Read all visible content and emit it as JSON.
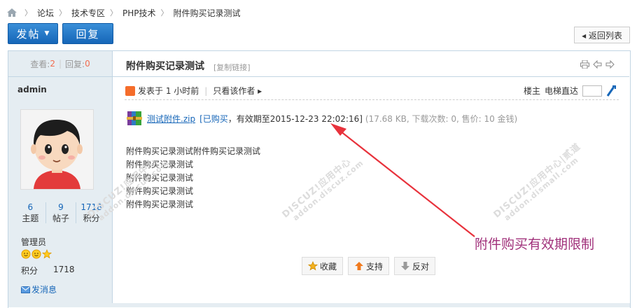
{
  "breadcrumb": [
    "论坛",
    "技术专区",
    "PHP技术",
    "附件购买记录测试"
  ],
  "toolbar": {
    "post_label": "发帖",
    "reply_label": "回复",
    "back_label": "◂ 返回列表"
  },
  "sidebar": {
    "views_label": "查看:",
    "views": "2",
    "replies_label": "回复:",
    "replies": "0",
    "username": "admin",
    "stats": [
      {
        "value": "6",
        "label": "主题"
      },
      {
        "value": "9",
        "label": "帖子"
      },
      {
        "value": "1718",
        "label": "积分"
      }
    ],
    "group": "管理员",
    "credit_label": "积分",
    "credit_value": "1718",
    "message_label": "发消息"
  },
  "thread": {
    "title": "附件购买记录测试",
    "copy_link": "[复制链接]"
  },
  "post": {
    "meta_posted": "发表于 1 小时前",
    "author_only": "只看该作者 ▸",
    "floor_label": "楼主",
    "elevator_label": "电梯直达"
  },
  "attachment": {
    "name": "测试附件.zip",
    "paid": "[已购买",
    "expiry": "，有效期至2015-12-23 22:02:16]",
    "meta": "(17.68 KB, 下载次数: 0, 售价: 10 金钱)"
  },
  "content_lines": [
    "附件购买记录测试附件购买记录测试",
    "附件购买记录测试",
    "附件购买记录测试",
    "附件购买记录测试",
    "附件购买记录测试"
  ],
  "annotation": "附件购买有效期限制",
  "actions": {
    "favorite": "收藏",
    "support": "支持",
    "oppose": "反对"
  },
  "watermarks": [
    "DISCUZ!应用中心",
    "addon.discuz.com",
    "DISCUZ!应用中心",
    "addon.discuz.com",
    "DISCUZ!应用中心|贰道",
    "addon.dismall.com"
  ],
  "colors": {
    "accent": "#1666b8",
    "sidebar_bg": "#e5edf2",
    "border": "#c2d5e3",
    "highlight": "#f26c4f",
    "annotation": "#a0307a"
  }
}
